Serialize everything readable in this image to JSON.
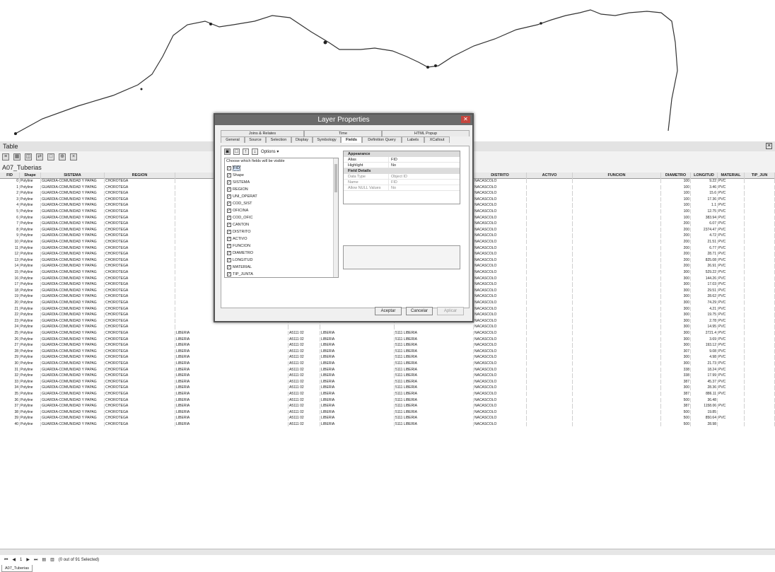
{
  "table_window": {
    "title": "Table",
    "close_glyph": "✕",
    "layer_name": "A07_Tuberias",
    "status": "(0 out of 91 Selected)",
    "record_nav": "1",
    "tab_label": "A07_Tuberias"
  },
  "columns": {
    "fid": "FID",
    "shape": "Shape",
    "sistema": "SISTEMA",
    "region": "REGION",
    "distrito": "DISTRITO",
    "activo": "ACTIVO",
    "funcion": "FUNCION",
    "diametro": "DIAMETRO",
    "longitud": "LONGITUD",
    "material": "MATERIAL",
    "tip_junta": "TIP_JUN"
  },
  "rows": [
    {
      "fid": "0",
      "shape": "Polyline",
      "sistema": "GUARDIA-COMUNIDAD Y PAPAG",
      "region": "CHOROTEGA",
      "c5": "",
      "c6": "",
      "c7": "",
      "c8": "",
      "distrito": "NACASCOLO",
      "diametro": "100",
      "longitud": "9.22",
      "material": "PVC"
    },
    {
      "fid": "1",
      "shape": "Polyline",
      "sistema": "GUARDIA-COMUNIDAD Y PAPAG",
      "region": "CHOROTEGA",
      "c5": "",
      "c6": "",
      "c7": "",
      "c8": "",
      "distrito": "NACASCOLO",
      "diametro": "100",
      "longitud": "3.46",
      "material": "PVC"
    },
    {
      "fid": "2",
      "shape": "Polyline",
      "sistema": "GUARDIA-COMUNIDAD Y PAPAG",
      "region": "CHOROTEGA",
      "c5": "",
      "c6": "",
      "c7": "",
      "c8": "",
      "distrito": "NACASCOLO",
      "diametro": "100",
      "longitud": "15.6",
      "material": "PVC"
    },
    {
      "fid": "3",
      "shape": "Polyline",
      "sistema": "GUARDIA-COMUNIDAD Y PAPAG",
      "region": "CHOROTEGA",
      "c5": "",
      "c6": "",
      "c7": "",
      "c8": "",
      "distrito": "NACASCOLO",
      "diametro": "100",
      "longitud": "17.36",
      "material": "PVC"
    },
    {
      "fid": "4",
      "shape": "Polyline",
      "sistema": "GUARDIA-COMUNIDAD Y PAPAG",
      "region": "CHOROTEGA",
      "c5": "",
      "c6": "",
      "c7": "",
      "c8": "",
      "distrito": "NACASCOLO",
      "diametro": "100",
      "longitud": "1.1",
      "material": "PVC"
    },
    {
      "fid": "5",
      "shape": "Polyline",
      "sistema": "GUARDIA-COMUNIDAD Y PAPAG",
      "region": "CHOROTEGA",
      "c5": "",
      "c6": "",
      "c7": "",
      "c8": "",
      "distrito": "NACASCOLO",
      "diametro": "100",
      "longitud": "12.75",
      "material": "PVC"
    },
    {
      "fid": "6",
      "shape": "Polyline",
      "sistema": "GUARDIA-COMUNIDAD Y PAPAG",
      "region": "CHOROTEGA",
      "c5": "",
      "c6": "",
      "c7": "",
      "c8": "",
      "distrito": "NACASCOLO",
      "diametro": "100",
      "longitud": "383.94",
      "material": "PVC"
    },
    {
      "fid": "7",
      "shape": "Polyline",
      "sistema": "GUARDIA-COMUNIDAD Y PAPAG",
      "region": "CHOROTEGA",
      "c5": "",
      "c6": "",
      "c7": "",
      "c8": "",
      "distrito": "NACASCOLO",
      "diametro": "200",
      "longitud": "6.07",
      "material": "PVC"
    },
    {
      "fid": "8",
      "shape": "Polyline",
      "sistema": "GUARDIA-COMUNIDAD Y PAPAG",
      "region": "CHOROTEGA",
      "c5": "",
      "c6": "",
      "c7": "",
      "c8": "",
      "distrito": "NACASCOLO",
      "diametro": "200",
      "longitud": "2374.47",
      "material": "PVC"
    },
    {
      "fid": "9",
      "shape": "Polyline",
      "sistema": "GUARDIA-COMUNIDAD Y PAPAG",
      "region": "CHOROTEGA",
      "c5": "",
      "c6": "",
      "c7": "",
      "c8": "",
      "distrito": "NACASCOLO",
      "diametro": "200",
      "longitud": "4.72",
      "material": "PVC"
    },
    {
      "fid": "10",
      "shape": "Polyline",
      "sistema": "GUARDIA-COMUNIDAD Y PAPAG",
      "region": "CHOROTEGA",
      "c5": "",
      "c6": "",
      "c7": "",
      "c8": "",
      "distrito": "NACASCOLO",
      "diametro": "200",
      "longitud": "21.51",
      "material": "PVC"
    },
    {
      "fid": "11",
      "shape": "Polyline",
      "sistema": "GUARDIA-COMUNIDAD Y PAPAG",
      "region": "CHOROTEGA",
      "c5": "",
      "c6": "",
      "c7": "",
      "c8": "",
      "distrito": "NACASCOLO",
      "diametro": "200",
      "longitud": "6.77",
      "material": "PVC"
    },
    {
      "fid": "12",
      "shape": "Polyline",
      "sistema": "GUARDIA-COMUNIDAD Y PAPAG",
      "region": "CHOROTEGA",
      "c5": "",
      "c6": "",
      "c7": "",
      "c8": "",
      "distrito": "NACASCOLO",
      "diametro": "200",
      "longitud": "28.71",
      "material": "PVC"
    },
    {
      "fid": "13",
      "shape": "Polyline",
      "sistema": "GUARDIA-COMUNIDAD Y PAPAG",
      "region": "CHOROTEGA",
      "c5": "",
      "c6": "",
      "c7": "",
      "c8": "",
      "distrito": "NACASCOLO",
      "diametro": "200",
      "longitud": "825.08",
      "material": "PVC"
    },
    {
      "fid": "14",
      "shape": "Polyline",
      "sistema": "GUARDIA-COMUNIDAD Y PAPAG",
      "region": "CHOROTEGA",
      "c5": "",
      "c6": "",
      "c7": "",
      "c8": "",
      "distrito": "NACASCOLO",
      "diametro": "200",
      "longitud": "26.91",
      "material": "PVC"
    },
    {
      "fid": "15",
      "shape": "Polyline",
      "sistema": "GUARDIA-COMUNIDAD Y PAPAG",
      "region": "CHOROTEGA",
      "c5": "",
      "c6": "",
      "c7": "",
      "c8": "",
      "distrito": "NACASCOLO",
      "diametro": "300",
      "longitud": "529.22",
      "material": "PVC"
    },
    {
      "fid": "16",
      "shape": "Polyline",
      "sistema": "GUARDIA-COMUNIDAD Y PAPAG",
      "region": "CHOROTEGA",
      "c5": "",
      "c6": "",
      "c7": "",
      "c8": "",
      "distrito": "NACASCOLO",
      "diametro": "300",
      "longitud": "144.26",
      "material": "PVC"
    },
    {
      "fid": "17",
      "shape": "Polyline",
      "sistema": "GUARDIA-COMUNIDAD Y PAPAG",
      "region": "CHOROTEGA",
      "c5": "",
      "c6": "",
      "c7": "",
      "c8": "",
      "distrito": "NACASCOLO",
      "diametro": "300",
      "longitud": "17.03",
      "material": "PVC"
    },
    {
      "fid": "18",
      "shape": "Polyline",
      "sistema": "GUARDIA-COMUNIDAD Y PAPAG",
      "region": "CHOROTEGA",
      "c5": "",
      "c6": "",
      "c7": "",
      "c8": "",
      "distrito": "NACASCOLO",
      "diametro": "300",
      "longitud": "29.51",
      "material": "PVC"
    },
    {
      "fid": "19",
      "shape": "Polyline",
      "sistema": "GUARDIA-COMUNIDAD Y PAPAG",
      "region": "CHOROTEGA",
      "c5": "",
      "c6": "",
      "c7": "",
      "c8": "",
      "distrito": "NACASCOLO",
      "diametro": "300",
      "longitud": "28.62",
      "material": "PVC"
    },
    {
      "fid": "20",
      "shape": "Polyline",
      "sistema": "GUARDIA-COMUNIDAD Y PAPAG",
      "region": "CHOROTEGA",
      "c5": "",
      "c6": "",
      "c7": "",
      "c8": "",
      "distrito": "NACASCOLO",
      "diametro": "300",
      "longitud": "74.29",
      "material": "PVC"
    },
    {
      "fid": "21",
      "shape": "Polyline",
      "sistema": "GUARDIA-COMUNIDAD Y PAPAG",
      "region": "CHOROTEGA",
      "c5": "",
      "c6": "",
      "c7": "",
      "c8": "",
      "distrito": "NACASCOLO",
      "diametro": "300",
      "longitud": "4.21",
      "material": "PVC"
    },
    {
      "fid": "22",
      "shape": "Polyline",
      "sistema": "GUARDIA-COMUNIDAD Y PAPAG",
      "region": "CHOROTEGA",
      "c5": "",
      "c6": "",
      "c7": "",
      "c8": "",
      "distrito": "NACASCOLO",
      "diametro": "300",
      "longitud": "19.75",
      "material": "PVC"
    },
    {
      "fid": "23",
      "shape": "Polyline",
      "sistema": "GUARDIA-COMUNIDAD Y PAPAG",
      "region": "CHOROTEGA",
      "c5": "",
      "c6": "",
      "c7": "",
      "c8": "",
      "distrito": "NACASCOLO",
      "diametro": "300",
      "longitud": "2.78",
      "material": "PVC"
    },
    {
      "fid": "24",
      "shape": "Polyline",
      "sistema": "GUARDIA-COMUNIDAD Y PAPAG",
      "region": "CHOROTEGA",
      "c5": "",
      "c6": "",
      "c7": "",
      "c8": "",
      "distrito": "NACASCOLO",
      "diametro": "300",
      "longitud": "14.95",
      "material": "PVC"
    },
    {
      "fid": "25",
      "shape": "Polyline",
      "sistema": "GUARDIA-COMUNIDAD Y PAPAG",
      "region": "CHOROTEGA",
      "c5": "LIBERIA",
      "c6": "A5111 02",
      "c7": "LIBERIA",
      "c8": "5111 LIBERIA",
      "distrito": "NACASCOLO",
      "diametro": "300",
      "longitud": "2721.4",
      "material": "PVC"
    },
    {
      "fid": "26",
      "shape": "Polyline",
      "sistema": "GUARDIA-COMUNIDAD Y PAPAG",
      "region": "CHOROTEGA",
      "c5": "LIBERIA",
      "c6": "A5111 02",
      "c7": "LIBERIA",
      "c8": "5111 LIBERIA",
      "distrito": "NACASCOLO",
      "diametro": "300",
      "longitud": "3.69",
      "material": "PVC"
    },
    {
      "fid": "27",
      "shape": "Polyline",
      "sistema": "GUARDIA-COMUNIDAD Y PAPAG",
      "region": "CHOROTEGA",
      "c5": "LIBERIA",
      "c6": "A5111 02",
      "c7": "LIBERIA",
      "c8": "5111 LIBERIA",
      "distrito": "NACASCOLO",
      "diametro": "300",
      "longitud": "193.12",
      "material": "PVC"
    },
    {
      "fid": "28",
      "shape": "Polyline",
      "sistema": "GUARDIA-COMUNIDAD Y PAPAG",
      "region": "CHOROTEGA",
      "c5": "LIBERIA",
      "c6": "A5111 02",
      "c7": "LIBERIA",
      "c8": "5111 LIBERIA",
      "distrito": "NACASCOLO",
      "diametro": "307",
      "longitud": "9.08",
      "material": "PVC"
    },
    {
      "fid": "29",
      "shape": "Polyline",
      "sistema": "GUARDIA-COMUNIDAD Y PAPAG",
      "region": "CHOROTEGA",
      "c5": "LIBERIA",
      "c6": "A5111 02",
      "c7": "LIBERIA",
      "c8": "5111 LIBERIA",
      "distrito": "NACASCOLO",
      "diametro": "300",
      "longitud": "4.98",
      "material": "PVC"
    },
    {
      "fid": "30",
      "shape": "Polyline",
      "sistema": "GUARDIA-COMUNIDAD Y PAPAG",
      "region": "CHOROTEGA",
      "c5": "LIBERIA",
      "c6": "A5111 02",
      "c7": "LIBERIA",
      "c8": "5111 LIBERIA",
      "distrito": "NACASCOLO",
      "diametro": "300",
      "longitud": "21.73",
      "material": "PVC"
    },
    {
      "fid": "31",
      "shape": "Polyline",
      "sistema": "GUARDIA-COMUNIDAD Y PAPAG",
      "region": "CHOROTEGA",
      "c5": "LIBERIA",
      "c6": "A5111 02",
      "c7": "LIBERIA",
      "c8": "5111 LIBERIA",
      "distrito": "NACASCOLO",
      "diametro": "338",
      "longitud": "18.24",
      "material": "PVC"
    },
    {
      "fid": "32",
      "shape": "Polyline",
      "sistema": "GUARDIA-COMUNIDAD Y PAPAG",
      "region": "CHOROTEGA",
      "c5": "LIBERIA",
      "c6": "A5111 02",
      "c7": "LIBERIA",
      "c8": "5111 LIBERIA",
      "distrito": "NACASCOLO",
      "diametro": "338",
      "longitud": "17.99",
      "material": "PVC"
    },
    {
      "fid": "33",
      "shape": "Polyline",
      "sistema": "GUARDIA-COMUNIDAD Y PAPAG",
      "region": "CHOROTEGA",
      "c5": "LIBERIA",
      "c6": "A5111 02",
      "c7": "LIBERIA",
      "c8": "5111 LIBERIA",
      "distrito": "NACASCOLO",
      "diametro": "387",
      "longitud": "45.37",
      "material": "PVC"
    },
    {
      "fid": "34",
      "shape": "Polyline",
      "sistema": "GUARDIA-COMUNIDAD Y PAPAG",
      "region": "CHOROTEGA",
      "c5": "LIBERIA",
      "c6": "A5111 02",
      "c7": "LIBERIA",
      "c8": "5111 LIBERIA",
      "distrito": "NACASCOLO",
      "diametro": "300",
      "longitud": "28.36",
      "material": "PVC"
    },
    {
      "fid": "35",
      "shape": "Polyline",
      "sistema": "GUARDIA-COMUNIDAD Y PAPAG",
      "region": "CHOROTEGA",
      "c5": "LIBERIA",
      "c6": "A5111 02",
      "c7": "LIBERIA",
      "c8": "5111 LIBERIA",
      "distrito": "NACASCOLO",
      "diametro": "387",
      "longitud": "886.11",
      "material": "PVC"
    },
    {
      "fid": "36",
      "shape": "Polyline",
      "sistema": "GUARDIA-COMUNIDAD Y PAPAG",
      "region": "CHOROTEGA",
      "c5": "LIBERIA",
      "c6": "A5111 02",
      "c7": "LIBERIA",
      "c8": "5111 LIBERIA",
      "distrito": "NACASCOLO",
      "diametro": "500",
      "longitud": "36.48",
      "material": ""
    },
    {
      "fid": "37",
      "shape": "Polyline",
      "sistema": "GUARDIA-COMUNIDAD Y PAPAG",
      "region": "CHOROTEGA",
      "c5": "LIBERIA",
      "c6": "A5111 02",
      "c7": "LIBERIA",
      "c8": "5111 LIBERIA",
      "distrito": "NACASCOLO",
      "diametro": "387",
      "longitud": "1158.06",
      "material": "PVC"
    },
    {
      "fid": "38",
      "shape": "Polyline",
      "sistema": "GUARDIA-COMUNIDAD Y PAPAG",
      "region": "CHOROTEGA",
      "c5": "LIBERIA",
      "c6": "A5111 02",
      "c7": "LIBERIA",
      "c8": "5111 LIBERIA",
      "distrito": "NACASCOLO",
      "diametro": "500",
      "longitud": "19.85",
      "material": ""
    },
    {
      "fid": "39",
      "shape": "Polyline",
      "sistema": "GUARDIA-COMUNIDAD Y PAPAG",
      "region": "CHOROTEGA",
      "c5": "LIBERIA",
      "c6": "A5111 02",
      "c7": "LIBERIA",
      "c8": "5111 LIBERIA",
      "distrito": "NACASCOLO",
      "diametro": "500",
      "longitud": "850.64",
      "material": "PVC"
    },
    {
      "fid": "40",
      "shape": "Polyline",
      "sistema": "GUARDIA-COMUNIDAD Y PAPAG",
      "region": "CHOROTEGA",
      "c5": "LIBERIA",
      "c6": "A5111 02",
      "c7": "LIBERIA",
      "c8": "5111 LIBERIA",
      "distrito": "NACASCOLO",
      "diametro": "500",
      "longitud": "28.98",
      "material": ""
    }
  ],
  "dialog": {
    "title": "Layer Properties",
    "close_glyph": "✕",
    "tabs_row1": [
      "Joins & Relates",
      "Time",
      "HTML Popup"
    ],
    "tabs_row2": [
      "General",
      "Source",
      "Selection",
      "Display",
      "Symbology",
      "Fields",
      "Definition Query",
      "Labels",
      "XCallout"
    ],
    "options_label": "Options ▾",
    "fields_caption": "Choose which fields will be visible",
    "fields": [
      "FID",
      "Shape",
      "SISTEMA",
      "REGION",
      "UNI_OPERAT",
      "COD_SIST",
      "OFICINA",
      "COD_OFIC",
      "CANTON",
      "DISTRITO",
      "ACTIVO",
      "FUNCION",
      "DIAMETRO",
      "LONGITUD",
      "MATERIAL",
      "TIP_JUNTA"
    ],
    "appearance": {
      "section": "Appearance",
      "alias_label": "Alias",
      "alias_value": "FID",
      "highlight_label": "Highlight",
      "highlight_value": "No"
    },
    "details": {
      "section": "Field Details",
      "datatype_label": "Data Type",
      "datatype_value": "Object ID",
      "name_label": "Name",
      "name_value": "FID",
      "nulls_label": "Allow NULL Values",
      "nulls_value": "No"
    },
    "buttons": {
      "ok": "Aceptar",
      "cancel": "Cancelar",
      "apply": "Aplicar"
    }
  }
}
